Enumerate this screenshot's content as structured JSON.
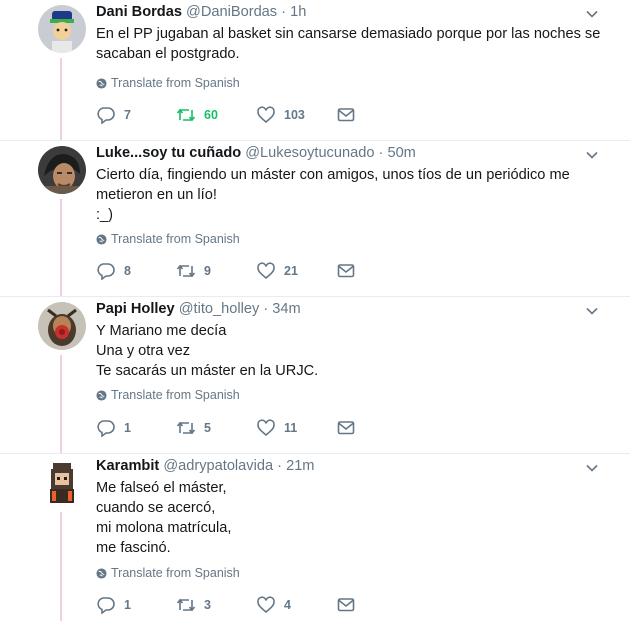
{
  "colors": {
    "retweet_active": "#17bf63",
    "muted": "#657786",
    "thread_line": "#f0cfe0"
  },
  "tweets": [
    {
      "name": "Dani Bordas",
      "handle": "@DaniBordas",
      "time": "1h",
      "lines": [
        "En el PP jugaban al basket sin cansarse demasiado porque por las noches se",
        "sacaban el postgrado."
      ],
      "translate": "Translate from Spanish",
      "replies": "7",
      "retweets": "60",
      "likes": "103",
      "retweeted": true
    },
    {
      "name": "Luke...soy tu cuñado",
      "handle": "@Lukesoytucunado",
      "time": "50m",
      "lines": [
        "Cierto día, fingiendo un máster con amigos, unos tíos de un periódico me",
        "metieron en un lío!",
        ":_)"
      ],
      "translate": "Translate from Spanish",
      "replies": "8",
      "retweets": "9",
      "likes": "21",
      "retweeted": false
    },
    {
      "name": "Papi Holley",
      "handle": "@tito_holley",
      "time": "34m",
      "lines": [
        "Y Mariano me decía",
        "Una y otra vez",
        "Te sacarás un máster en la URJC."
      ],
      "translate": "Translate from Spanish",
      "replies": "1",
      "retweets": "5",
      "likes": "11",
      "retweeted": false
    },
    {
      "name": "Karambit",
      "handle": "@adrypatolavida",
      "time": "21m",
      "lines": [
        "Me falseó el máster,",
        "cuando se acercó,",
        "mi molona matrícula,",
        "me fascinó."
      ],
      "translate": "Translate from Spanish",
      "replies": "1",
      "retweets": "3",
      "likes": "4",
      "retweeted": false
    }
  ]
}
